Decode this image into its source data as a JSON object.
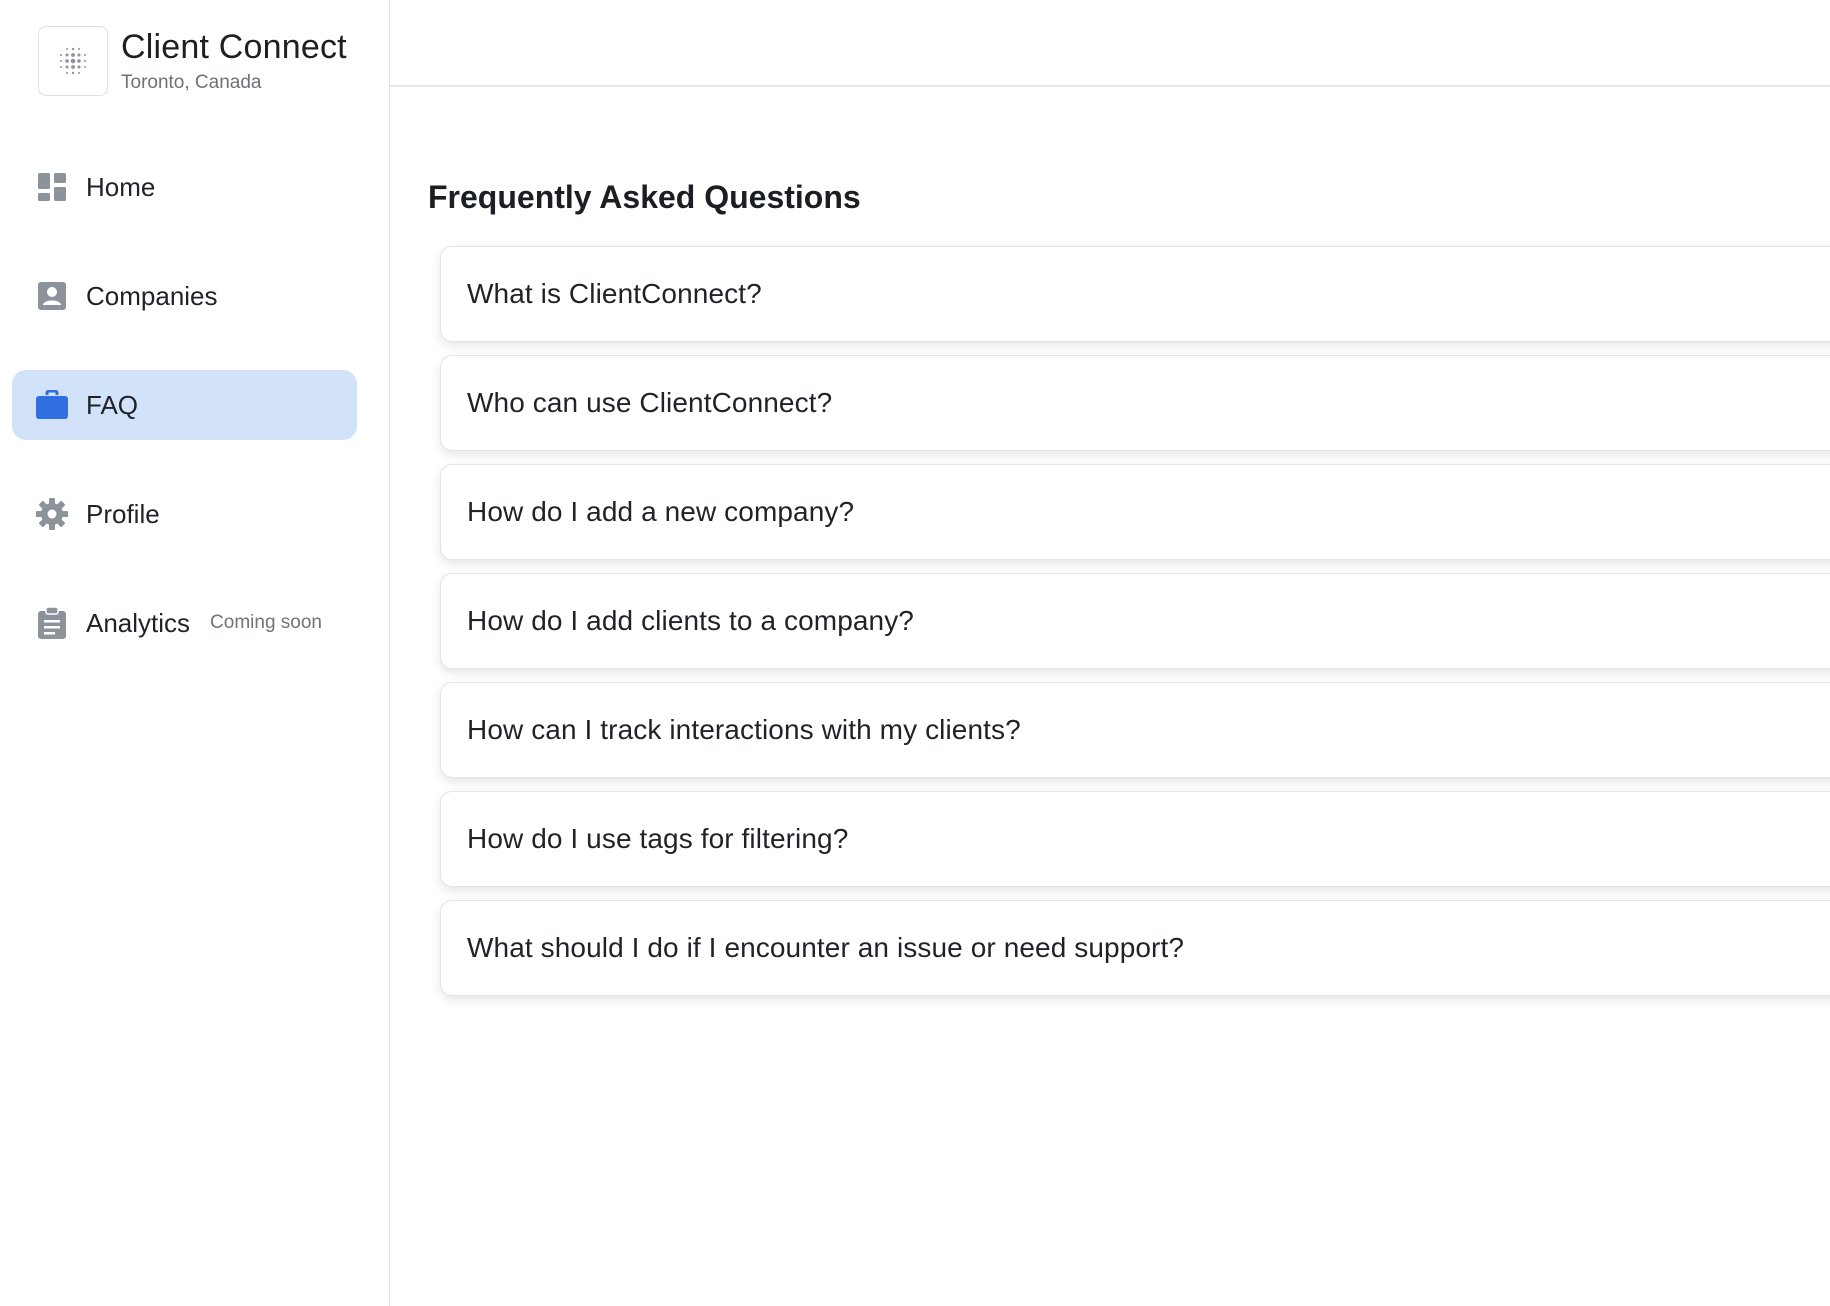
{
  "brand": {
    "title": "Client Connect",
    "subtitle": "Toronto, Canada",
    "logo_icon": "dotted-grid-logo-icon"
  },
  "sidebar": {
    "items": [
      {
        "label": "Home",
        "icon": "dashboard-icon",
        "active": false
      },
      {
        "label": "Companies",
        "icon": "contact-card-icon",
        "active": false
      },
      {
        "label": "FAQ",
        "icon": "briefcase-icon",
        "active": true
      },
      {
        "label": "Profile",
        "icon": "gear-icon",
        "active": false
      },
      {
        "label": "Analytics",
        "icon": "clipboard-icon",
        "active": false,
        "tag": "Coming soon"
      }
    ]
  },
  "main": {
    "title": "Frequently Asked Questions",
    "faqs": [
      {
        "question": "What is ClientConnect?"
      },
      {
        "question": "Who can use ClientConnect?"
      },
      {
        "question": "How do I add a new company?"
      },
      {
        "question": "How do I add clients to a company?"
      },
      {
        "question": "How can I track interactions with my clients?"
      },
      {
        "question": "How do I use tags for filtering?"
      },
      {
        "question": "What should I do if I encounter an issue or need support?"
      }
    ]
  },
  "colors": {
    "active_nav_bg": "#d2e2f8",
    "active_icon": "#2f6fe0",
    "inactive_icon": "#8d939b",
    "border": "#e3e5e8"
  }
}
